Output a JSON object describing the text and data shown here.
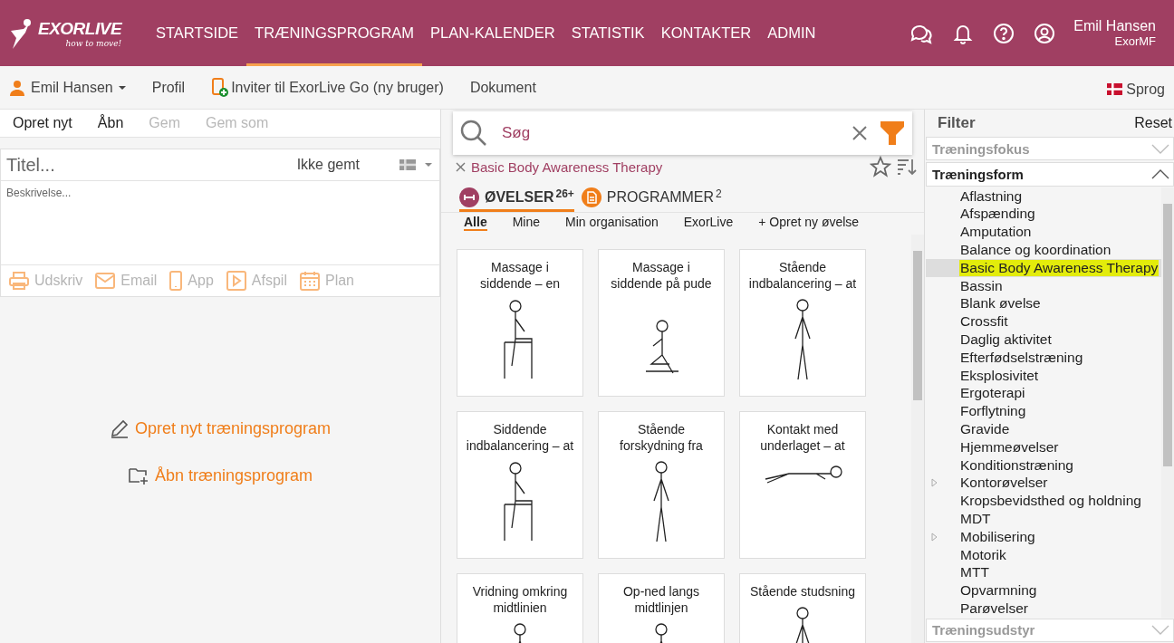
{
  "header": {
    "logo": {
      "name": "EXORLIVE",
      "tagline": "how to move!"
    },
    "nav": [
      {
        "label": "STARTSIDE",
        "selected": false
      },
      {
        "label": "TRÆNINGSPROGRAM",
        "selected": true
      },
      {
        "label": "PLAN-KALENDER",
        "selected": false
      },
      {
        "label": "STATISTIK",
        "selected": false
      },
      {
        "label": "KONTAKTER",
        "selected": false
      },
      {
        "label": "ADMIN",
        "selected": false
      }
    ],
    "user": {
      "name": "Emil Hansen",
      "org": "ExorMF"
    }
  },
  "subbar": {
    "user_menu": "Emil Hansen",
    "profile_link": "Profil",
    "invite_link": "Inviter til ExorLive Go (ny bruger)",
    "document_link": "Dokument",
    "language": "Sprog"
  },
  "program": {
    "toolbar": [
      {
        "label": "Opret nyt",
        "disabled": false
      },
      {
        "label": "Åbn",
        "disabled": false
      },
      {
        "label": "Gem",
        "disabled": true
      },
      {
        "label": "Gem som",
        "disabled": true
      }
    ],
    "title_placeholder": "Titel...",
    "save_status": "Ikke gemt",
    "description_placeholder": "Beskrivelse...",
    "actions": [
      {
        "kind": "print",
        "label": "Udskriv"
      },
      {
        "kind": "email",
        "label": "Email"
      },
      {
        "kind": "app",
        "label": "App"
      },
      {
        "kind": "play",
        "label": "Afspil"
      },
      {
        "kind": "plan",
        "label": "Plan"
      }
    ],
    "create_link": "Opret nyt træningsprogram",
    "open_link": "Åbn træningsprogram"
  },
  "search": {
    "placeholder": "Søg",
    "active_filter": "Basic Body Awareness Therapy",
    "tabs": [
      {
        "kind": "exercises",
        "label": "ØVELSER",
        "count": "26+",
        "selected": true
      },
      {
        "kind": "programs",
        "label": "PROGRAMMER",
        "count": "2",
        "selected": false
      }
    ],
    "subtabs": [
      {
        "label": "Alle",
        "selected": true
      },
      {
        "label": "Mine",
        "selected": false
      },
      {
        "label": "Min organisation",
        "selected": false
      },
      {
        "label": "ExorLive",
        "selected": false
      },
      {
        "label": "+ Opret ny øvelse",
        "selected": false
      }
    ],
    "exercises": [
      {
        "kind": "seated",
        "title": "Massage i siddende – en"
      },
      {
        "kind": "kneeling",
        "title": "Massage i siddende på pude"
      },
      {
        "kind": "standing",
        "title": "Stående indbalancering – at"
      },
      {
        "kind": "seated",
        "title": "Siddende indbalancering – at"
      },
      {
        "kind": "standing",
        "title": "Stående forskydning fra"
      },
      {
        "kind": "lying",
        "title": "Kontakt med underlaget – at"
      },
      {
        "kind": "standing",
        "title": "Vridning omkring midtlinien"
      },
      {
        "kind": "standing",
        "title": "Op-ned langs midtlinjen"
      },
      {
        "kind": "standing",
        "title": "Stående studsning"
      }
    ]
  },
  "filter": {
    "title": "Filter",
    "reset": "Reset",
    "sections": [
      {
        "label": "Træningsfokus",
        "expanded": false
      },
      {
        "label": "Træningsform",
        "expanded": true,
        "items": [
          {
            "label": "Aflastning",
            "selected": false,
            "has_children": false
          },
          {
            "label": "Afspænding",
            "selected": false,
            "has_children": false
          },
          {
            "label": "Amputation",
            "selected": false,
            "has_children": false
          },
          {
            "label": "Balance og koordination",
            "selected": false,
            "has_children": false
          },
          {
            "label": "Basic Body Awareness Therapy",
            "selected": true,
            "has_children": false
          },
          {
            "label": "Bassin",
            "selected": false,
            "has_children": false
          },
          {
            "label": "Blank øvelse",
            "selected": false,
            "has_children": false
          },
          {
            "label": "Crossfit",
            "selected": false,
            "has_children": false
          },
          {
            "label": "Daglig aktivitet",
            "selected": false,
            "has_children": false
          },
          {
            "label": "Efterfødselstræning",
            "selected": false,
            "has_children": false
          },
          {
            "label": "Eksplosivitet",
            "selected": false,
            "has_children": false
          },
          {
            "label": "Ergoterapi",
            "selected": false,
            "has_children": false
          },
          {
            "label": "Forflytning",
            "selected": false,
            "has_children": false
          },
          {
            "label": "Gravide",
            "selected": false,
            "has_children": false
          },
          {
            "label": "Hjemmeøvelser",
            "selected": false,
            "has_children": false
          },
          {
            "label": "Konditionstræning",
            "selected": false,
            "has_children": false
          },
          {
            "label": "Kontorøvelser",
            "selected": false,
            "has_children": true
          },
          {
            "label": "Kropsbevidsthed og holdning",
            "selected": false,
            "has_children": false
          },
          {
            "label": "MDT",
            "selected": false,
            "has_children": false
          },
          {
            "label": "Mobilisering",
            "selected": false,
            "has_children": true
          },
          {
            "label": "Motorik",
            "selected": false,
            "has_children": false
          },
          {
            "label": "MTT",
            "selected": false,
            "has_children": false
          },
          {
            "label": "Opvarmning",
            "selected": false,
            "has_children": false
          },
          {
            "label": "Parøvelser",
            "selected": false,
            "has_children": false
          }
        ]
      },
      {
        "label": "Træningsudstyr",
        "expanded": false
      }
    ]
  }
}
